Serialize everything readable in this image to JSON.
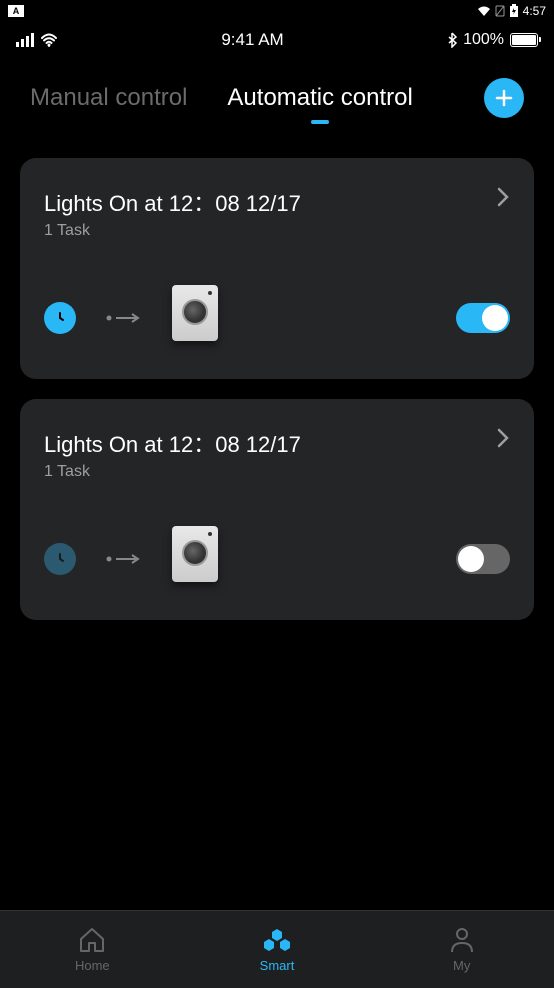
{
  "android_status": {
    "time": "4:57",
    "indicator": "A"
  },
  "app_status": {
    "time": "9:41 AM",
    "battery": "100%"
  },
  "tabs": {
    "manual": "Manual control",
    "automatic": "Automatic control"
  },
  "tasks": [
    {
      "title": "Lights On at 12：08 12/17",
      "subtitle": "1 Task",
      "enabled": true
    },
    {
      "title": "Lights On at 12：08 12/17",
      "subtitle": "1 Task",
      "enabled": false
    }
  ],
  "nav": {
    "home": "Home",
    "smart": "Smart",
    "my": "My"
  }
}
